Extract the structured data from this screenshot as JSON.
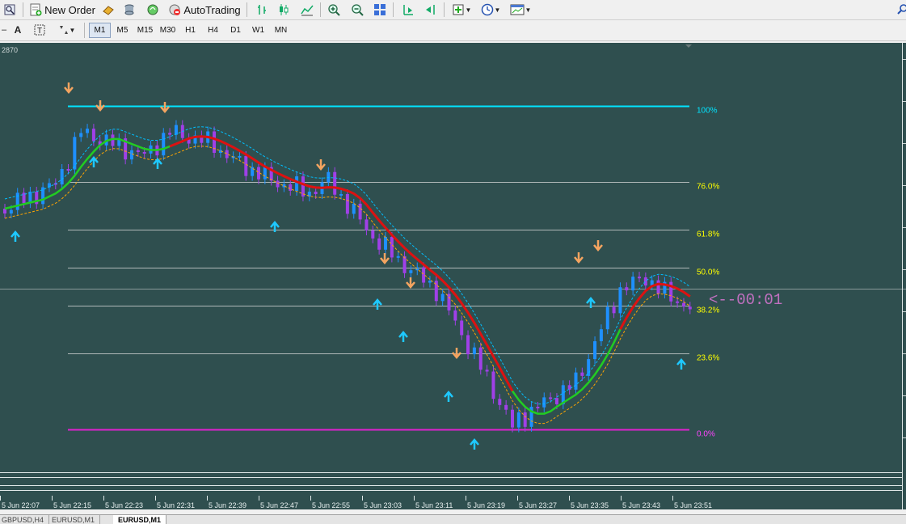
{
  "toolbar": {
    "new_order_label": "New Order",
    "autotrading_label": "AutoTrading"
  },
  "timeframes": [
    "M1",
    "M5",
    "M15",
    "M30",
    "H1",
    "H4",
    "D1",
    "W1",
    "MN"
  ],
  "active_timeframe": "M1",
  "chart": {
    "price_label": "2870",
    "countdown": "<--00:01",
    "colors": {
      "background": "#2f4f4f",
      "bull_candle": "#1e90ff",
      "bear_candle": "#a040e8",
      "fib_top_line": "#00e5ff",
      "fib_bottom_line": "#e020d0",
      "fib_level_line": "#b0b8b8",
      "fib_label": "#ffff00",
      "fib_top_label": "#00e5ff",
      "fib_bottom_label": "#ff44ff",
      "ma_green": "#22cc22",
      "ma_red": "#dd1111",
      "envelope_upper": "#00bfff",
      "envelope_lower": "#ffa500",
      "arrow_down": "#f4a460",
      "arrow_up": "#1ec8ff",
      "countdown": "#c070c0"
    },
    "fib_levels": [
      {
        "pct": 100,
        "label": "100%"
      },
      {
        "pct": 76.4,
        "label": "76.0%"
      },
      {
        "pct": 61.8,
        "label": "61.8%"
      },
      {
        "pct": 50,
        "label": "50.0%"
      },
      {
        "pct": 38.2,
        "label": "38.2%"
      },
      {
        "pct": 23.6,
        "label": "23.6%"
      },
      {
        "pct": 0,
        "label": "0.0%"
      }
    ],
    "time_labels": [
      "5 Jun 22:07",
      "5 Jun 22:15",
      "5 Jun 22:23",
      "5 Jun 22:31",
      "5 Jun 22:39",
      "5 Jun 22:47",
      "5 Jun 22:55",
      "5 Jun 23:03",
      "5 Jun 23:11",
      "5 Jun 23:19",
      "5 Jun 23:27",
      "5 Jun 23:35",
      "5 Jun 23:43",
      "5 Jun 23:51"
    ]
  },
  "tabs": [
    "GBPUSD,H4",
    "EURUSD,M1",
    "EURUSD,M1"
  ],
  "active_tab": 2
}
